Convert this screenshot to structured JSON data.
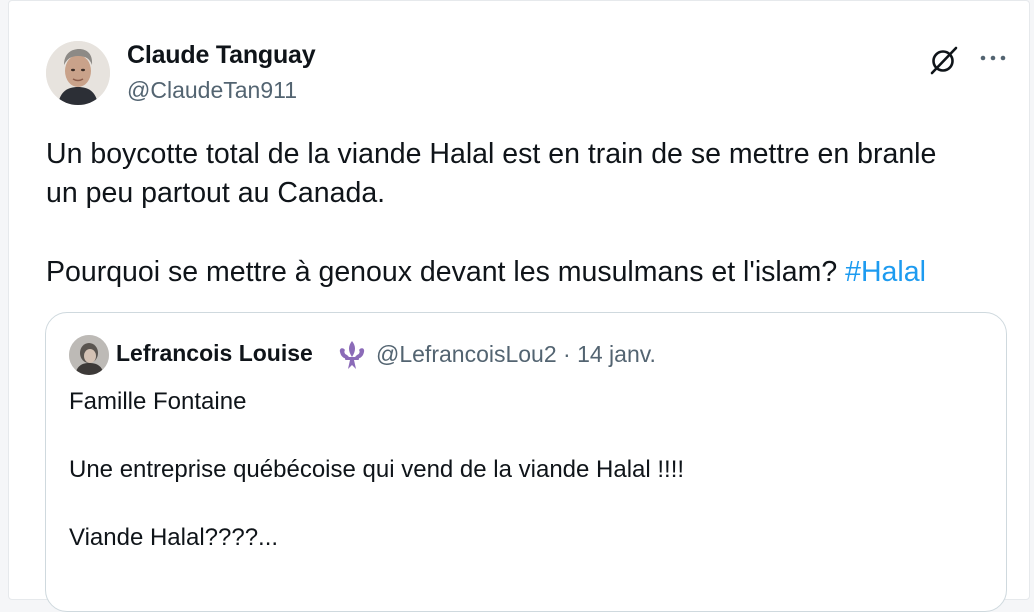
{
  "author": {
    "name": "Claude Tanguay",
    "handle": "@ClaudeTan911"
  },
  "post": {
    "line1": "Un boycotte total de la viande Halal est en train de se mettre en branle",
    "line2": "un peu partout au Canada.",
    "line3": "Pourquoi se mettre à genoux devant les musulmans et l'islam?",
    "hashtag": "#Halal"
  },
  "icons": {
    "grok": "grok-icon",
    "more": "more-icon",
    "fleur": "fleur-de-lis-icon"
  },
  "quote": {
    "name": "Lefrancois Louise",
    "handle_and_date": "@LefrancoisLou2 · 14 janv.",
    "line1": "Famille Fontaine",
    "line2": "Une entreprise québécoise qui vend de la viande Halal !!!!",
    "line3": "Viande Halal????..."
  },
  "colors": {
    "link": "#1d9bf0",
    "secondary_text": "#536471",
    "fleur": "#8b6bb8"
  }
}
